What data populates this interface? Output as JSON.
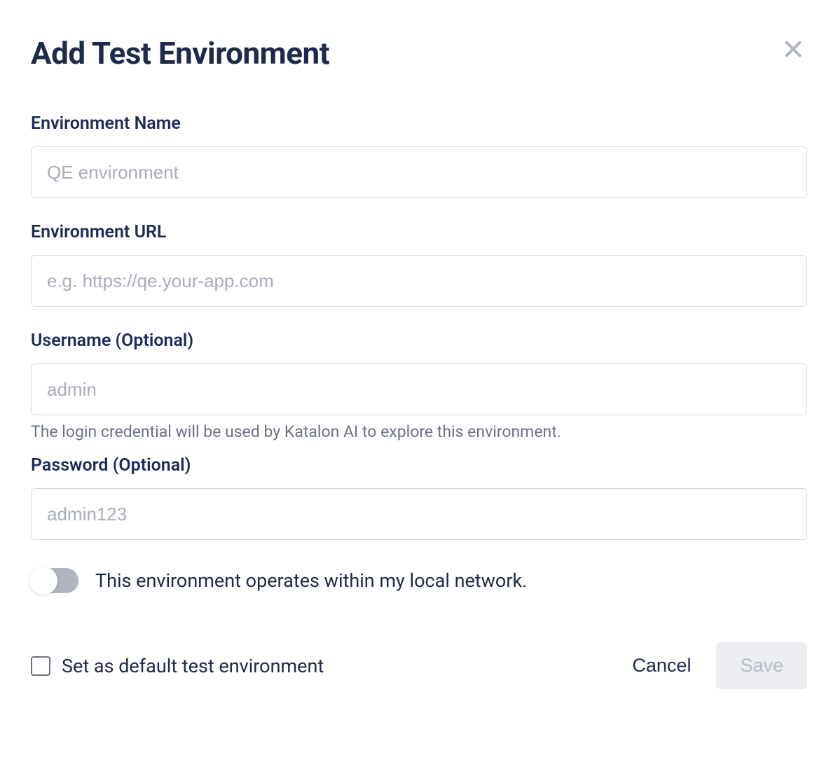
{
  "dialog": {
    "title": "Add Test Environment"
  },
  "fields": {
    "env_name": {
      "label": "Environment Name",
      "placeholder": "QE environment",
      "value": ""
    },
    "env_url": {
      "label": "Environment URL",
      "placeholder": "e.g. https://qe.your-app.com",
      "value": ""
    },
    "username": {
      "label": "Username (Optional)",
      "placeholder": "admin",
      "value": "",
      "helper": "The login credential will be used by Katalon AI to explore this environment."
    },
    "password": {
      "label": "Password (Optional)",
      "placeholder": "admin123",
      "value": ""
    }
  },
  "toggle": {
    "label": "This environment operates within my local network.",
    "checked": false
  },
  "footer": {
    "checkbox_label": "Set as default test environment",
    "checkbox_checked": false,
    "cancel_label": "Cancel",
    "save_label": "Save"
  }
}
